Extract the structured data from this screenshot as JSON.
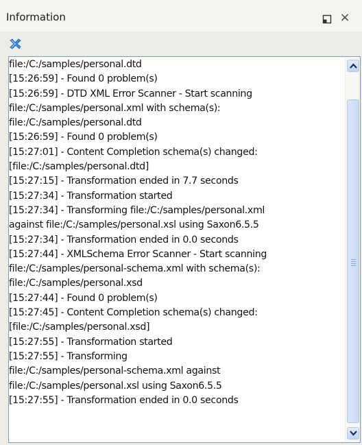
{
  "panel": {
    "title": "Information",
    "restore_icon": "restore-icon",
    "close_icon": "close-icon",
    "close_glyph": "×"
  },
  "toolbar": {
    "clear_icon": "clear-log-icon"
  },
  "console": {
    "lines": [
      "file:/C:/samples/personal.dtd",
      "[15:26:59] - Found 0 problem(s)",
      "[15:26:59] - DTD XML Error Scanner - Start scanning",
      "file:/C:/samples/personal.xml with schema(s):",
      "file:/C:/samples/personal.dtd",
      "[15:26:59] - Found 0 problem(s)",
      "[15:27:01] - Content Completion schema(s) changed:",
      "[file:/C:/samples/personal.dtd]",
      "[15:27:15] - Transformation ended in 7.7 seconds",
      "[15:27:34] - Transformation started",
      "[15:27:34] - Transforming file:/C:/samples/personal.xml",
      "against file:/C:/samples/personal.xsl using Saxon6.5.5",
      "[15:27:34] - Transformation ended in 0.0 seconds",
      "[15:27:44] - XMLSchema Error Scanner - Start scanning",
      "file:/C:/samples/personal-schema.xml with schema(s):",
      "file:/C:/samples/personal.xsd",
      "[15:27:44] - Found 0 problem(s)",
      "[15:27:45] - Content Completion schema(s) changed:",
      "[file:/C:/samples/personal.xsd]",
      "[15:27:55] - Transformation started",
      "[15:27:55] - Transforming",
      "file:/C:/samples/personal-schema.xml against",
      "file:/C:/samples/personal.xsl using Saxon6.5.5",
      "[15:27:55] - Transformation ended in 0.0 seconds"
    ]
  },
  "scrollbar": {
    "up_icon": "scroll-up-arrow-icon",
    "down_icon": "scroll-down-arrow-icon"
  },
  "colors": {
    "panel_bg": "#ecebe6",
    "console_bg": "#ffffff",
    "border": "#7f9db9",
    "scroll_accent": "#c3d3f3",
    "clear_icon": "#3a8de0"
  }
}
